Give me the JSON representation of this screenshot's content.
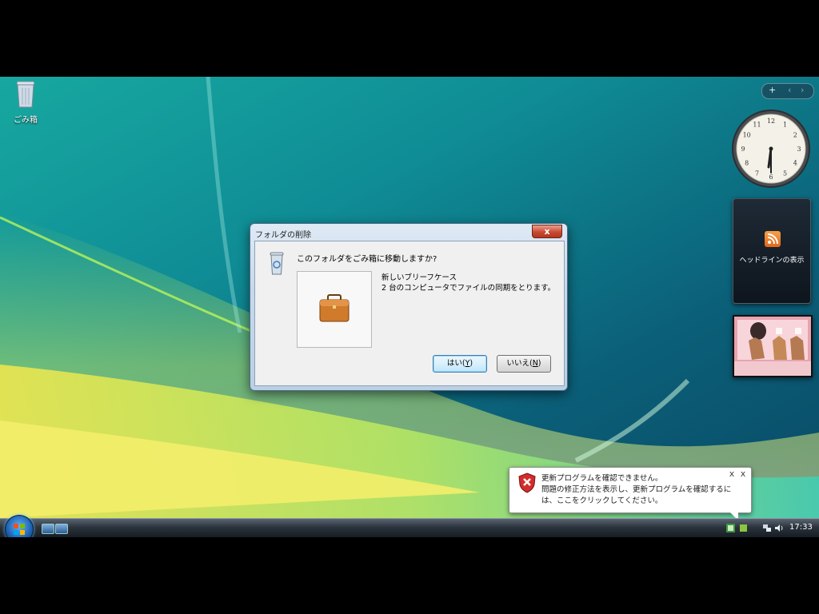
{
  "desktop": {
    "recycle_bin_label": "ごみ箱"
  },
  "sidebar": {
    "controls": {
      "add": "+",
      "prev": "‹",
      "next": "›"
    },
    "clock": {
      "numerals": [
        "12",
        "1",
        "2",
        "3",
        "4",
        "5",
        "6",
        "7",
        "8",
        "9",
        "10",
        "11"
      ],
      "time_shown": "5:30"
    },
    "feed_gadget": {
      "label": "ヘッドラインの表示",
      "icon": "rss-icon"
    },
    "slideshow_gadget": {
      "icon": "slideshow-picture"
    }
  },
  "dialog": {
    "title": "フォルダの削除",
    "close_label": "x",
    "question": "このフォルダをごみ箱に移動しますか?",
    "item_name": "新しいブリーフケース",
    "item_description": "2 台のコンピュータでファイルの同期をとります。",
    "yes_button": {
      "text": "はい(",
      "key": "Y",
      "end": ")"
    },
    "no_button": {
      "text": "いいえ(",
      "key": "N",
      "end": ")"
    }
  },
  "notification": {
    "line1": "更新プログラムを確認できません。",
    "line2": "問題の修正方法を表示し、更新プログラムを確認するに",
    "line3": "は、ここをクリックしてください。",
    "close_label": "x",
    "icon": "shield-error-icon"
  },
  "taskbar": {
    "clock": "17:33",
    "quick_launch": [
      "show-desktop-icon",
      "switch-windows-icon"
    ],
    "tray_icons": [
      "security-center-icon",
      "update-icon",
      "network-icon",
      "volume-icon"
    ]
  },
  "colors": {
    "wallpaper_teal": "#0e7f86",
    "wallpaper_green": "#7fd23a",
    "dialog_close_red": "#c94a32",
    "default_button_blue": "#3c7fb1"
  }
}
